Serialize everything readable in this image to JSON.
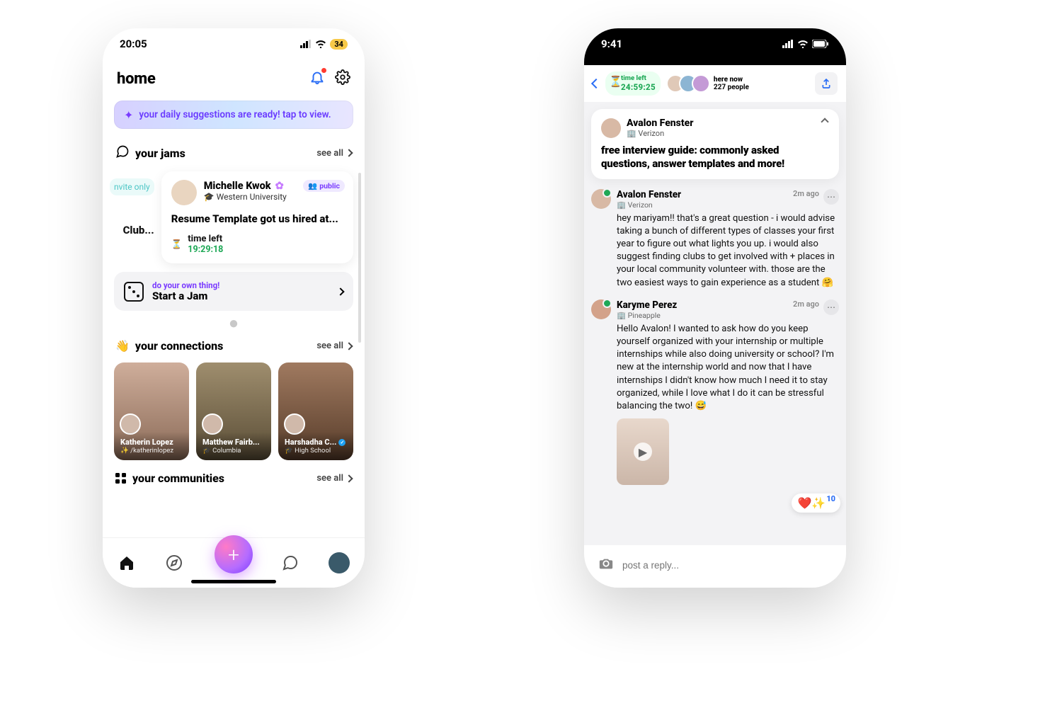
{
  "left": {
    "status": {
      "time": "20:05",
      "battery": "34"
    },
    "title": "home",
    "banner": "your daily suggestions are ready! tap to view.",
    "sections": {
      "jams_title": "your jams",
      "see_all": "see all",
      "connections_title": "your connections",
      "communities_title": "your communities"
    },
    "invite_chip": "nvite only",
    "club_trunc": "Club...",
    "jam": {
      "name": "Michelle Kwok",
      "org": "🎓 Western University",
      "public": "public",
      "title": "Resume Template got us hired at...",
      "time_label": "time left",
      "time_value": "19:29:18"
    },
    "start_jam": {
      "kicker": "do your own thing!",
      "label": "Start a Jam"
    },
    "connections": [
      {
        "name": "Katherin Lopez",
        "sub": "✨ /katherinlopez",
        "verified": false
      },
      {
        "name": "Matthew Fairb...",
        "sub": "🎓 Columbia",
        "verified": false
      },
      {
        "name": "Harshadha C...",
        "sub": "🎓 High School",
        "verified": true
      }
    ]
  },
  "right": {
    "status": {
      "time": "9:41"
    },
    "top": {
      "time_label": "time left",
      "time_value": "24:59:25",
      "here_label": "here now",
      "here_value": "227 people"
    },
    "pinned": {
      "name": "Avalon Fenster",
      "org": "🏢 Verizon",
      "title": "free interview guide: commonly asked questions, answer templates and more!"
    },
    "messages": [
      {
        "name": "Avalon Fenster",
        "org": "🏢 Verizon",
        "time": "2m ago",
        "text": "hey mariyam!! that's a great question - i would advise taking a bunch of different types of classes your first year to figure out what lights you up. i would also suggest finding clubs to get involved with + places in your local community volunteer with. those are the two easiest ways to gain experience as a student 🤗"
      },
      {
        "name": "Karyme Perez",
        "org": "🏢 Pineapple",
        "time": "2m ago",
        "text": "Hello Avalon! I wanted to ask how do you keep yourself organized with your internship or multiple internships while also doing university or school? I'm new at the internship world and now that I have internships I didn't know how much I need it to stay organized, while I love what I do it can be stressful balancing the two! 😅"
      }
    ],
    "reply_placeholder": "post a reply...",
    "reactions": {
      "emoji": "❤️✨",
      "count": "10"
    }
  }
}
